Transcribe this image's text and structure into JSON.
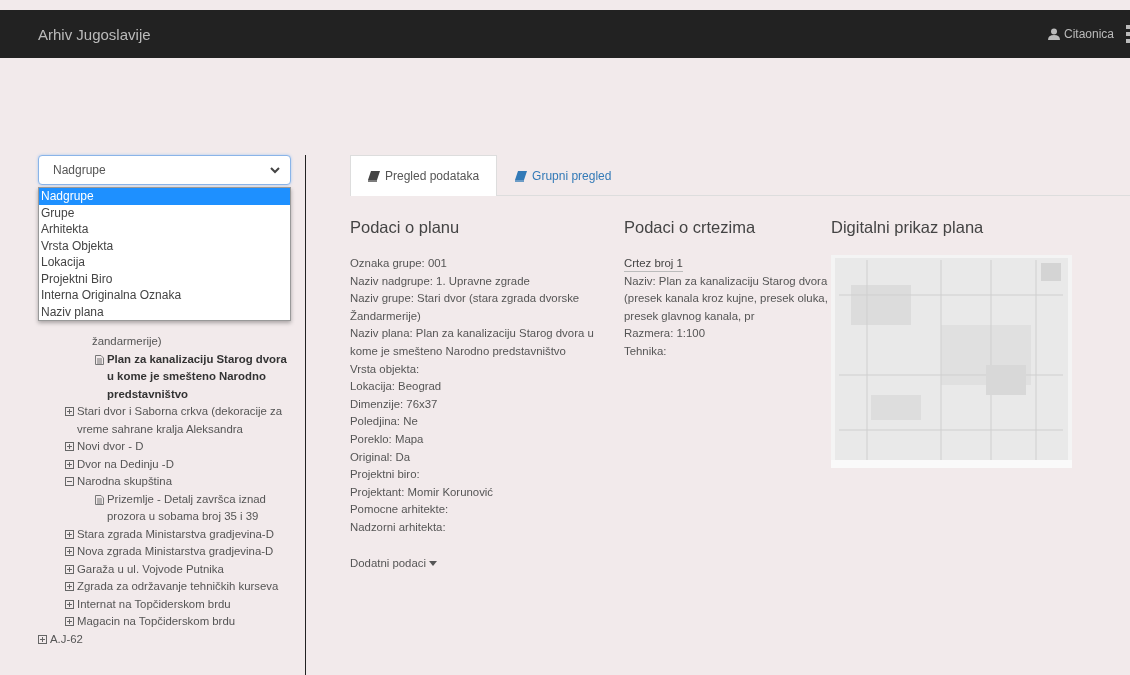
{
  "navbar": {
    "title": "Arhiv Jugoslavije",
    "user": "Citaonica"
  },
  "filter": {
    "value": "Nadgrupe",
    "open": true,
    "options": [
      {
        "label": "Nadgrupe",
        "selected": true
      },
      {
        "label": "Grupe",
        "selected": false
      },
      {
        "label": "Arhitekta",
        "selected": false
      },
      {
        "label": "Vrsta Objekta",
        "selected": false
      },
      {
        "label": "Lokacija",
        "selected": false
      },
      {
        "label": "Projektni Biro",
        "selected": false
      },
      {
        "label": "Interna Originalna Oznaka",
        "selected": false
      },
      {
        "label": "Naziv plana",
        "selected": false
      }
    ]
  },
  "tree": [
    {
      "kind": "fragment",
      "label": "žandarmerije)",
      "children": [
        {
          "kind": "document",
          "label": "Plan za kanalizaciju Starog dvora u kome je smešteno Narodno predstavništvo",
          "selected": true
        }
      ]
    },
    {
      "kind": "group",
      "label": "Stari dvor i Saborna crkva (dekoracije za vreme sahrane kralja Aleksandra",
      "expanded": false
    },
    {
      "kind": "group",
      "label": "Novi dvor - D",
      "expanded": false
    },
    {
      "kind": "group",
      "label": "Dvor na Dedinju -D",
      "expanded": false
    },
    {
      "kind": "group",
      "label": "Narodna skupština",
      "expanded": true,
      "children": [
        {
          "kind": "document",
          "label": "Prizemlje - Detalj završca iznad prozora u sobama broj 35 i 39",
          "selected": false
        }
      ]
    },
    {
      "kind": "group",
      "label": "Stara zgrada Ministarstva gradjevina-D",
      "expanded": false
    },
    {
      "kind": "group",
      "label": "Nova zgrada Ministarstva gradjevina-D",
      "expanded": false
    },
    {
      "kind": "group",
      "label": "Garaža u ul. Vojvode Putnika",
      "expanded": false
    },
    {
      "kind": "group",
      "label": "Zgrada za održavanje tehničkih kurseva",
      "expanded": false
    },
    {
      "kind": "group",
      "label": "Internat na Topčiderskom brdu",
      "expanded": false
    },
    {
      "kind": "group",
      "label": "Magacin na Topčiderskom brdu",
      "expanded": false
    }
  ],
  "root_items": [
    {
      "kind": "group",
      "label": "A.J-62",
      "expanded": false
    }
  ],
  "tabs": [
    {
      "label": "Pregled podataka",
      "selected": true
    },
    {
      "label": "Grupni pregled",
      "selected": false
    }
  ],
  "plan_info": {
    "title": "Podaci o planu",
    "lines": [
      "Oznaka grupe: 001",
      "Naziv nadgrupe: 1. Upravne zgrade",
      "Naziv grupe: Stari dvor (stara zgrada dvorske Žandarmerije)",
      "Naziv plana: Plan za kanalizaciju Starog dvora u kome je smešteno Narodno predstavništvo",
      "Vrsta objekta:",
      "Lokacija: Beograd",
      "Dimenzije: 76x37",
      "Poledjina: Ne",
      "Poreklo: Mapa",
      "Original: Da",
      "Projektni biro:",
      "Projektant: Momir Korunović",
      "Pomocne arhitekte:",
      "Nadzorni arhitekta:"
    ],
    "more_link": "Dodatni podaci"
  },
  "drawing_info": {
    "title": "Podaci o crtezima",
    "drawing_link": "Crtez broj 1",
    "lines": [
      "Naziv: Plan za kanalizaciju Starog dvora (presek kanala kroz kujne, presek oluka, presek glavnog kanala, pr",
      "Razmera: 1:100",
      "Tehnika:"
    ]
  },
  "digital": {
    "title": "Digitalni prikaz plana"
  }
}
